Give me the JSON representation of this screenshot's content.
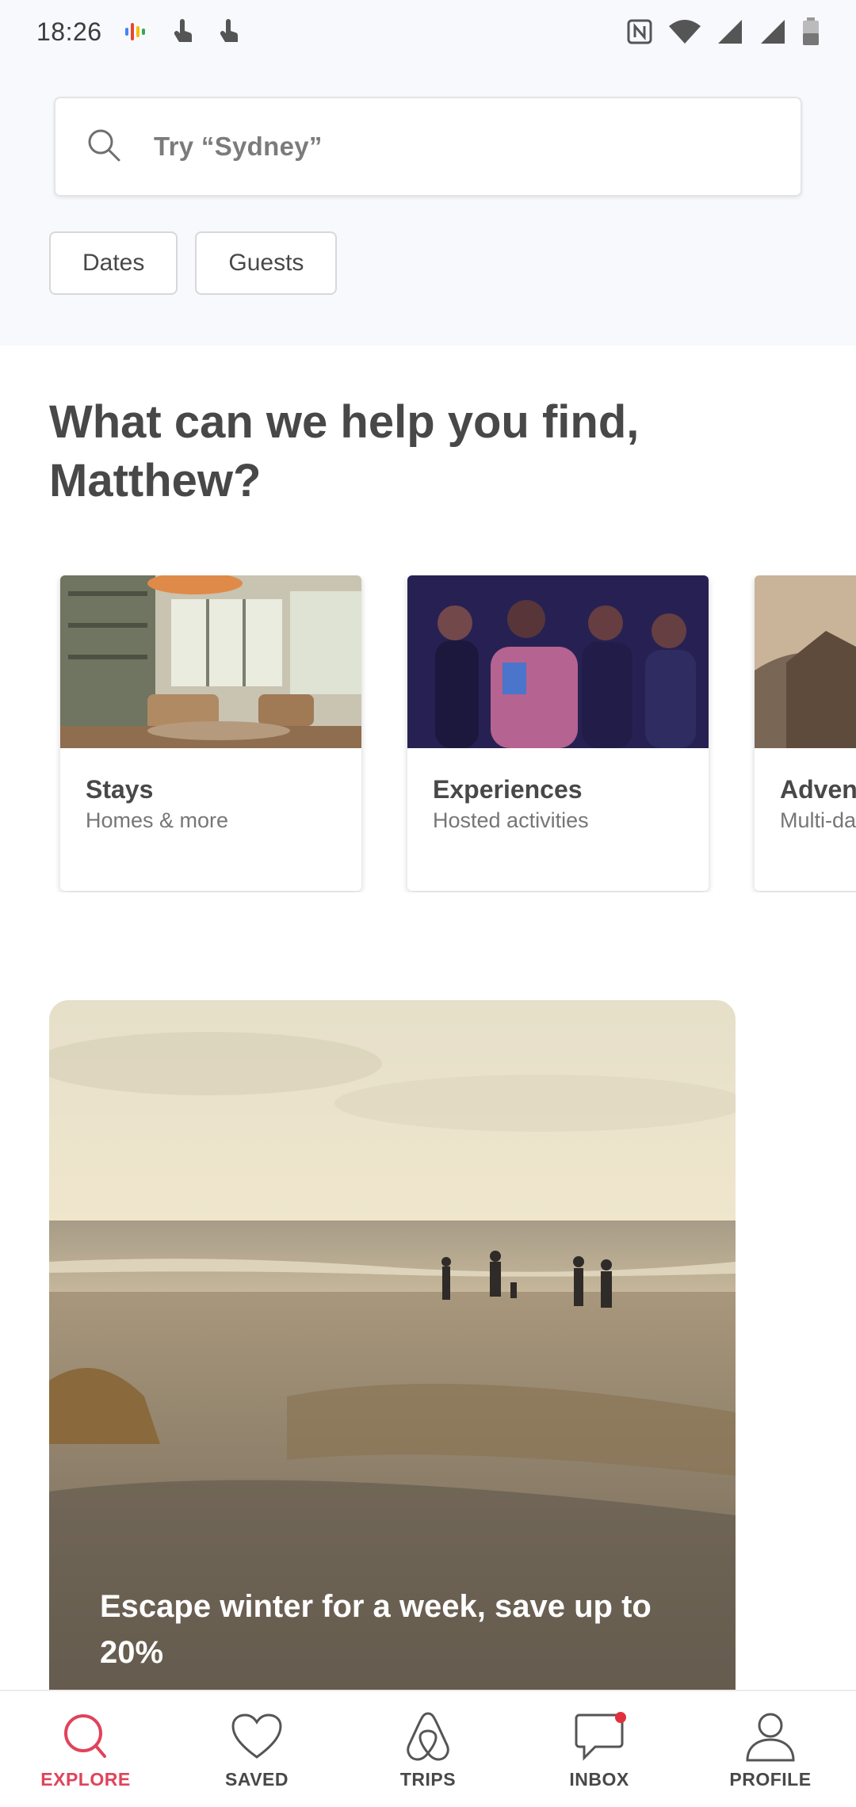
{
  "status_bar": {
    "time": "18:26",
    "left_icons": [
      "google-assistant-icon",
      "touch-icon",
      "touch-icon"
    ],
    "right_icons": [
      "nfc-icon",
      "wifi-icon",
      "signal-icon",
      "signal-icon",
      "battery-icon"
    ]
  },
  "search": {
    "placeholder": "Try “Sydney”",
    "icon": "search-icon"
  },
  "filters": [
    "Dates",
    "Guests"
  ],
  "heading": "What can we help you find, Matthew?",
  "categories": [
    {
      "title": "Stays",
      "subtitle": "Homes & more"
    },
    {
      "title": "Experiences",
      "subtitle": "Hosted activities"
    },
    {
      "title": "Adven",
      "subtitle": "Multi-da"
    }
  ],
  "promo": {
    "text": "Escape winter for a week, save up to 20%"
  },
  "bottom_nav": [
    {
      "label": "EXPLORE",
      "icon": "search-icon",
      "active": true
    },
    {
      "label": "SAVED",
      "icon": "heart-icon",
      "active": false
    },
    {
      "label": "TRIPS",
      "icon": "airbnb-logo-icon",
      "active": false
    },
    {
      "label": "INBOX",
      "icon": "chat-icon",
      "active": false,
      "badge": true
    },
    {
      "label": "PROFILE",
      "icon": "person-icon",
      "active": false
    }
  ],
  "colors": {
    "accent": "#e0435b",
    "text": "#484848",
    "subtext": "#767676",
    "top_background": "#f7f9fc"
  }
}
